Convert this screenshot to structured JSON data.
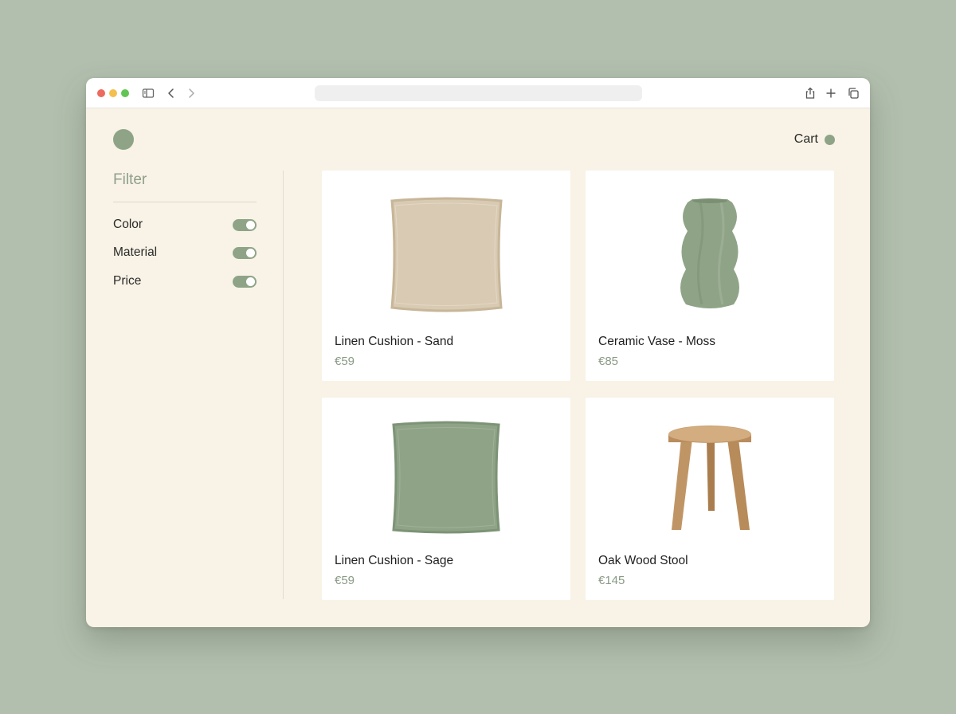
{
  "browser": {
    "icons": [
      "sidebar-icon",
      "back-icon",
      "forward-icon",
      "share-icon",
      "new-tab-icon",
      "tabs-icon"
    ]
  },
  "header": {
    "cart_label": "Cart"
  },
  "filter": {
    "title": "Filter",
    "options": [
      {
        "label": "Color",
        "enabled": true
      },
      {
        "label": "Material",
        "enabled": true
      },
      {
        "label": "Price",
        "enabled": true
      }
    ]
  },
  "products": [
    {
      "name": "Linen Cushion - Sand",
      "price": "€59",
      "image": "sand-cushion"
    },
    {
      "name": "Ceramic Vase - Moss",
      "price": "€85",
      "image": "moss-vase"
    },
    {
      "name": "Linen Cushion - Sage",
      "price": "€59",
      "image": "sage-cushion"
    },
    {
      "name": "Oak Wood Stool",
      "price": "€145",
      "image": "oak-stool"
    }
  ],
  "colors": {
    "accent": "#8fa487",
    "page_background": "#b2bfae",
    "content_background": "#f8f3e6",
    "card_background": "#ffffff"
  }
}
